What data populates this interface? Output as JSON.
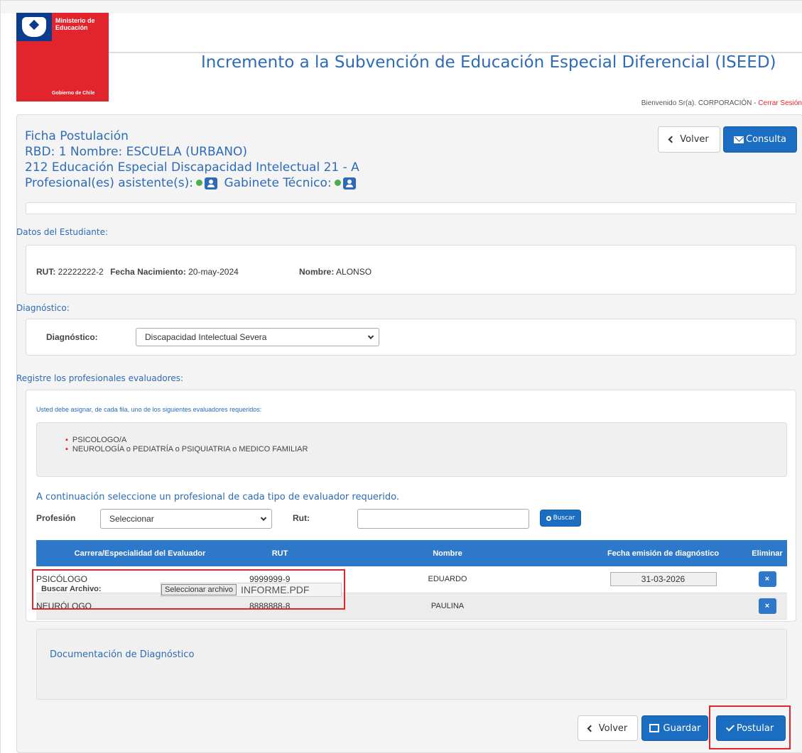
{
  "header": {
    "logo_line1": "Ministerio de",
    "logo_line2": "Educación",
    "logo_footer": "Gobierno de Chile",
    "title": "Incremento a la Subvención de Educación Especial Diferencial (ISEED)",
    "welcome": "Bienvenido Sr(a). CORPORACIÓN - ",
    "logout": "Cerrar Sesión"
  },
  "ficha": {
    "title": "Ficha Postulación",
    "rbd": "RBD: 1  Nombre: ESCUELA  (URBANO)",
    "course": "212 Educación Especial Discapacidad Intelectual 21 - A",
    "asistentes_label": "Profesional(es) asistente(s):",
    "gabinete_label": "Gabinete Técnico:",
    "volver": "Volver",
    "consulta": "Consulta"
  },
  "estudiante": {
    "section": "Datos del Estudiante:",
    "rut_label": "RUT:",
    "rut": "22222222-2",
    "fecha_label": "Fecha Nacimiento:",
    "fecha": "20-may-2024",
    "nombre_label": "Nombre:",
    "nombre": "ALONSO"
  },
  "diagnostico": {
    "section": "Diagnóstico:",
    "label": "Diagnóstico:",
    "value": "Discapacidad Intelectual Severa"
  },
  "evaluadores": {
    "section": "Registre los profesionales evaluadores:",
    "instruction": "Usted debe asignar, de cada fila, uno de los siguientes evaluadores requeridos:",
    "required": [
      "PSICOLOGO/A",
      "NEUROLOGÍA o PEDIATRÍA o PSIQUIATRIA o MEDICO FAMILIAR"
    ],
    "subtitle": "A continuación seleccione un profesional de cada tipo de evaluador requerido.",
    "profesion_label": "Profesión",
    "profesion_value": "Seleccionar",
    "rut_label": "Rut:",
    "rut_value": "",
    "buscar": "Buscar"
  },
  "table": {
    "headers": [
      "Carrera/Especialidad del Evaluador",
      "RUT",
      "Nombre",
      "Fecha emisión de diagnóstico",
      "Eliminar"
    ],
    "rows": [
      {
        "carrera": "PSICÓLOGO",
        "rut": "9999999-9",
        "nombre": "EDUARDO",
        "fecha": "31-03-2026"
      },
      {
        "carrera": "NEURÓLOGO",
        "rut": "8888888-8",
        "nombre": "PAULINA",
        "fecha": ""
      }
    ],
    "delete_icon": "×"
  },
  "documentacion": {
    "title": "Documentación de Diagnóstico",
    "buscar_label": "Buscar Archivo:",
    "file_button": "Seleccionar archivo",
    "file_name": "INFORME.PDF"
  },
  "footer": {
    "volver": "Volver",
    "guardar": "Guardar",
    "postular": "Postular"
  },
  "colors": {
    "brand_blue": "#2d6bb6",
    "primary": "#1b6dc1",
    "gov_red": "#e2242d",
    "status_green": "#4cae4c"
  }
}
